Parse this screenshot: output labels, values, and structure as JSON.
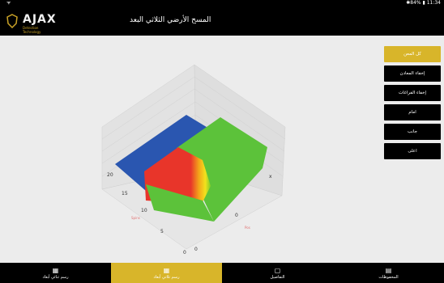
{
  "status": {
    "wifi": "ᯤ",
    "right": "✱84% ▮ 11:34"
  },
  "app": {
    "logo_text": "AJAX",
    "logo_sub": "Detection Technology",
    "title": "المسح الأرضي الثلاثي البعد"
  },
  "side_buttons": [
    {
      "label": "كل المعن"
    },
    {
      "label": "إخفاء المعادن"
    },
    {
      "label": "إخفاء الفراغات"
    },
    {
      "label": "امام"
    },
    {
      "label": "جانب"
    },
    {
      "label": "اعلى"
    }
  ],
  "plot": {
    "ticks": [
      "20",
      "15",
      "10",
      "5",
      "0"
    ],
    "tick_right": [
      "x",
      "0",
      "0"
    ],
    "axis_label_left": "Spins",
    "axis_label_right": "Pos"
  },
  "bottom_nav": [
    {
      "label": "رسم ثنائي أبعاد",
      "icon": "▦"
    },
    {
      "label": "رسم ثلاثي أبعاد",
      "icon": "▦"
    },
    {
      "label": "التفاصيل",
      "icon": "▢"
    },
    {
      "label": "المحفوظات",
      "icon": "▤"
    }
  ],
  "colors": {
    "accent": "#d8b52a",
    "bar": "#000000",
    "blue": "#2a56b0",
    "green": "#5cc23a",
    "red": "#e8352a"
  }
}
